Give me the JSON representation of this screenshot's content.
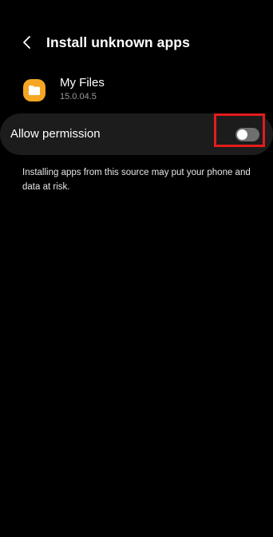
{
  "header": {
    "back_icon": "chevron-left-icon",
    "title": "Install unknown apps"
  },
  "app": {
    "icon": "folder-icon",
    "icon_color": "#f5a623",
    "name": "My Files",
    "version": "15.0.04.5"
  },
  "permission": {
    "label": "Allow permission",
    "enabled": false,
    "highlight_color": "#e51b1b"
  },
  "warning_text": "Installing apps from this source may put your phone and data at risk."
}
